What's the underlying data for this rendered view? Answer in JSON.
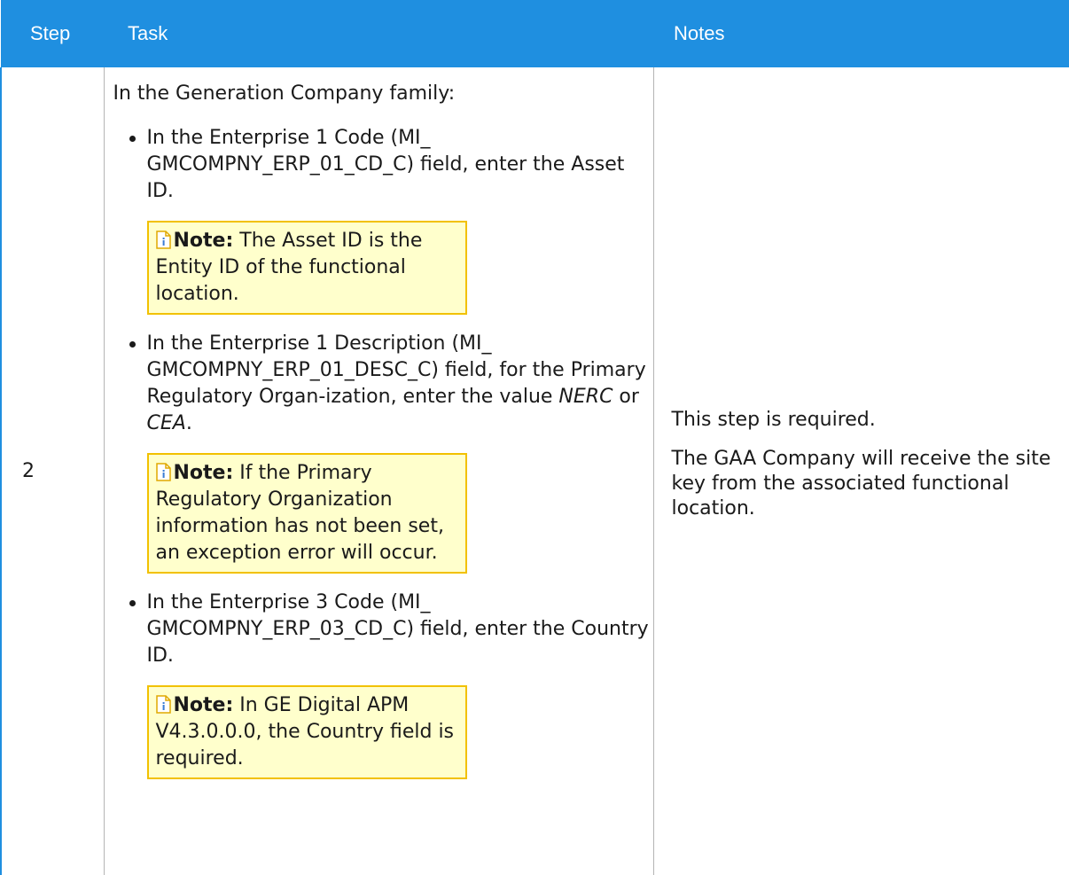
{
  "header": {
    "step": "Step",
    "task": "Task",
    "notes": "Notes"
  },
  "row": {
    "step": "2",
    "intro": "In the Generation Company family:",
    "items": [
      {
        "text": "In the Enterprise 1 Code (MI_ GMCOMPNY_ERP_01_CD_C) field, enter the Asset ID.",
        "note_label": "Note:",
        "note_text": " The Asset ID is the Entity ID of the functional location."
      },
      {
        "text_a": "In the Enterprise 1 Description (MI_ GMCOMPNY_ERP_01_DESC_C) field, for the Primary Regulatory Organ-ization, enter the value ",
        "em1": "NERC",
        "text_b": " or ",
        "em2": "CEA",
        "text_c": ".",
        "note_label": "Note:",
        "note_text": " If the Primary Regulatory Organization information has not been set, an exception error will occur."
      },
      {
        "text": "In the Enterprise 3 Code (MI_ GMCOMPNY_ERP_03_CD_C) field, enter the Country ID.",
        "note_label": "Note:",
        "note_text": " In GE Digital APM V4.3.0.0.0, the Country field is required."
      }
    ],
    "notes": [
      "This step is required.",
      "The GAA Company will receive the site key from the associated functional location."
    ]
  },
  "colors": {
    "header_bg": "#1f8fe0",
    "note_bg": "#ffffcc",
    "note_border": "#f2c100"
  },
  "icons": {
    "note": "note-document-icon"
  }
}
